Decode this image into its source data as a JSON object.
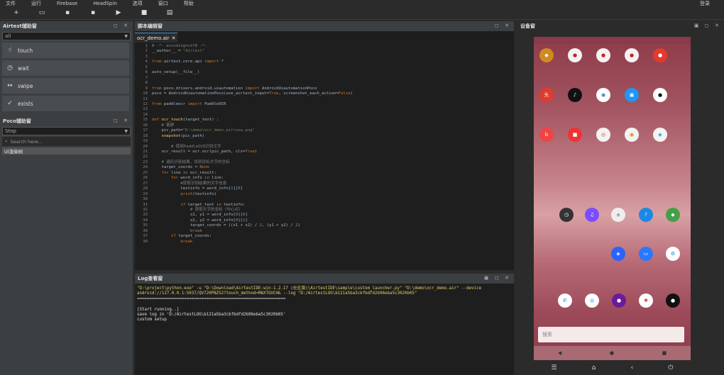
{
  "menu": {
    "items": [
      "文件",
      "运行",
      "Firebase",
      "HeadSpin",
      "选项",
      "窗口",
      "帮助"
    ],
    "login": "登录"
  },
  "left": {
    "airtest_title": "Airtest辅助窗",
    "airtest_select": "all",
    "actions": [
      {
        "label": "touch",
        "icon": "hand-icon"
      },
      {
        "label": "wait",
        "icon": "clock-icon"
      },
      {
        "label": "swipe",
        "icon": "swipe-icon"
      },
      {
        "label": "exists",
        "icon": "check-circle-icon"
      }
    ],
    "poco_title": "Poco辅助窗",
    "poco_select": "Stop",
    "search_placeholder": "Search here...",
    "tree_item": "UI渲染树"
  },
  "editor": {
    "title": "脚本编辑窗",
    "tab": "ocr_demo.air"
  },
  "log": {
    "title": "Log查看窗"
  },
  "device": {
    "title": "设备窗",
    "search_hint": "搜索"
  }
}
